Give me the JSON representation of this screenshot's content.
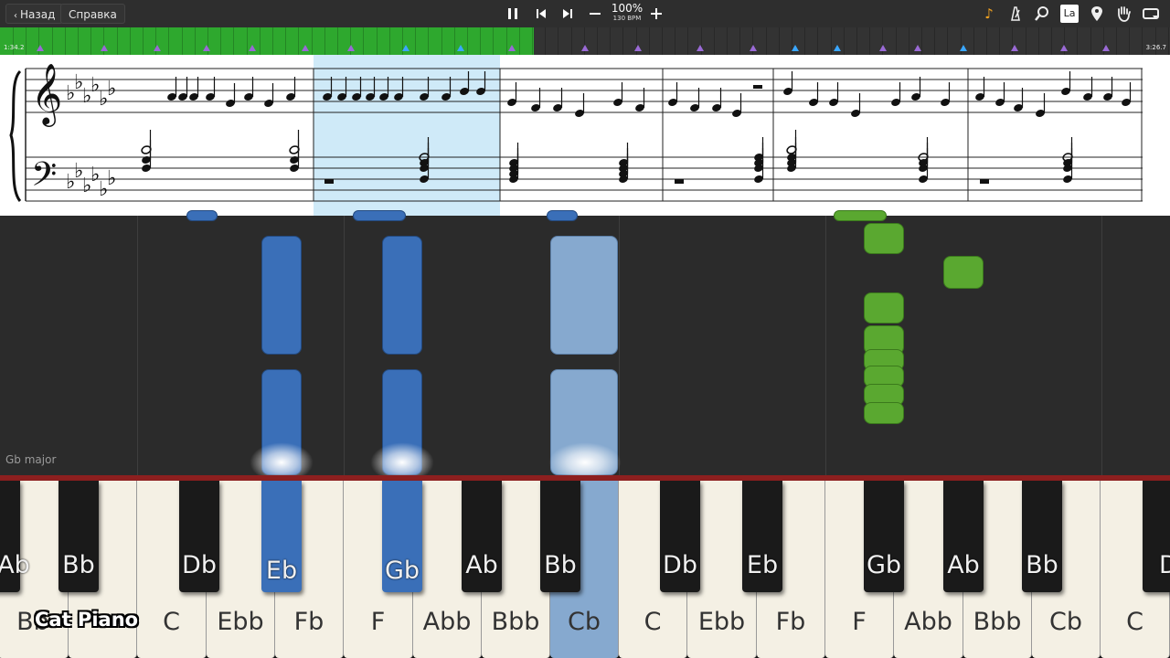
{
  "toolbar": {
    "back_label": "Назад",
    "help_label": "Справка",
    "tempo_percent": "100%",
    "tempo_bpm": "130 BPM"
  },
  "timeline": {
    "start_time": "1:34.2",
    "end_time": "3:26.7",
    "progress": 0.456
  },
  "score": {
    "key_signature": "Gb major",
    "flats": 6
  },
  "roll": {
    "key_label": "Gb major"
  },
  "keyboard": {
    "white_keys": [
      "Bb",
      "",
      "C",
      "Ebb",
      "Fb",
      "F",
      "Abb",
      "Bbb",
      "Cb",
      "C",
      "Ebb",
      "Fb",
      "F",
      "Abb",
      "Bbb",
      "Cb",
      "C"
    ],
    "black_keys": [
      "Ab",
      "Bb",
      "Db",
      "Eb",
      "Gb",
      "Ab",
      "Bb",
      "Db",
      "Eb",
      "Gb",
      "Ab",
      "Bb",
      "Db"
    ],
    "pressed_white": [
      "Cb"
    ],
    "pressed_black": [
      "Eb",
      "Gb"
    ]
  },
  "watermark": "Cat Piano",
  "colors": {
    "progress": "#2ea82e",
    "left_hand": "#3a6fb8",
    "left_hand_light": "#86a9cf",
    "right_hand": "#5aa830",
    "highlight": "#cfeaf8",
    "red_bar": "#8d1f1f"
  }
}
